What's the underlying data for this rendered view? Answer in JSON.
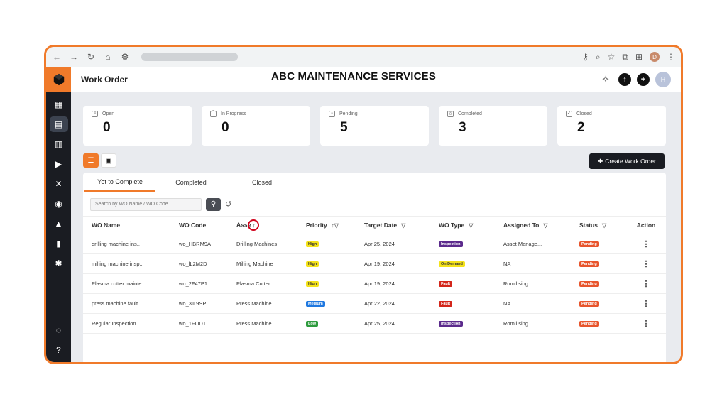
{
  "header": {
    "page_title": "Work Order",
    "app_title": "ABC MAINTENANCE SERVICES",
    "user_initial": "H",
    "browser_profile_initial": "D"
  },
  "stats": [
    {
      "label": "Open",
      "value": "0",
      "icon": "list-icon"
    },
    {
      "label": "In Progress",
      "value": "0",
      "icon": "chart-icon"
    },
    {
      "label": "Pending",
      "value": "5",
      "icon": "clipboard-icon"
    },
    {
      "label": "Completed",
      "value": "3",
      "icon": "target-icon"
    },
    {
      "label": "Closed",
      "value": "2",
      "icon": "check-circle-icon"
    }
  ],
  "toolbar": {
    "create_label": "Create Work Order"
  },
  "tabs": [
    {
      "label": "Yet to Complete",
      "active": true
    },
    {
      "label": "Completed",
      "active": false
    },
    {
      "label": "Closed",
      "active": false
    }
  ],
  "search": {
    "placeholder": "Search by WO Name / WO Code"
  },
  "table": {
    "headers": {
      "wo_name": "WO Name",
      "wo_code": "WO Code",
      "asset": "Asse",
      "priority": "Priority",
      "target_date": "Target Date",
      "wo_type": "WO Type",
      "assigned_to": "Assigned To",
      "status": "Status",
      "action": "Action"
    },
    "rows": [
      {
        "wo_name": "drilling machine ins..",
        "wo_code": "wo_HBRM9A",
        "asset": "Drilling Machines",
        "priority": "High",
        "target_date": "Apr 25, 2024",
        "wo_type": "Inspection",
        "assigned_to": "Asset Manage...",
        "status": "Pending"
      },
      {
        "wo_name": "milling machine insp..",
        "wo_code": "wo_lL2M2D",
        "asset": "Milling Machine",
        "priority": "High",
        "target_date": "Apr 19, 2024",
        "wo_type": "On Demand",
        "assigned_to": "NA",
        "status": "Pending"
      },
      {
        "wo_name": "Plasma cutter mainte..",
        "wo_code": "wo_2F47P1",
        "asset": "Plasma Cutter",
        "priority": "High",
        "target_date": "Apr 19, 2024",
        "wo_type": "Fault",
        "assigned_to": "Romil sing",
        "status": "Pending"
      },
      {
        "wo_name": "press machine fault",
        "wo_code": "wo_3IL9SP",
        "asset": "Press Machine",
        "priority": "Medium",
        "target_date": "Apr 22, 2024",
        "wo_type": "Fault",
        "assigned_to": "NA",
        "status": "Pending"
      },
      {
        "wo_name": "Regular Inspection",
        "wo_code": "wo_1FIJDT",
        "asset": "Press Machine",
        "priority": "Low",
        "target_date": "Apr 25, 2024",
        "wo_type": "Inspection",
        "assigned_to": "Romil sing",
        "status": "Pending"
      }
    ]
  },
  "colors": {
    "accent": "#f07a2a",
    "priority_high": "#f4e21a",
    "priority_medium": "#1f78e0",
    "priority_low": "#2e9b3e",
    "type_inspection": "#5b2a8c",
    "type_on_demand": "#f4e21a",
    "type_fault": "#d3261a",
    "status_pending": "#e8552c"
  }
}
